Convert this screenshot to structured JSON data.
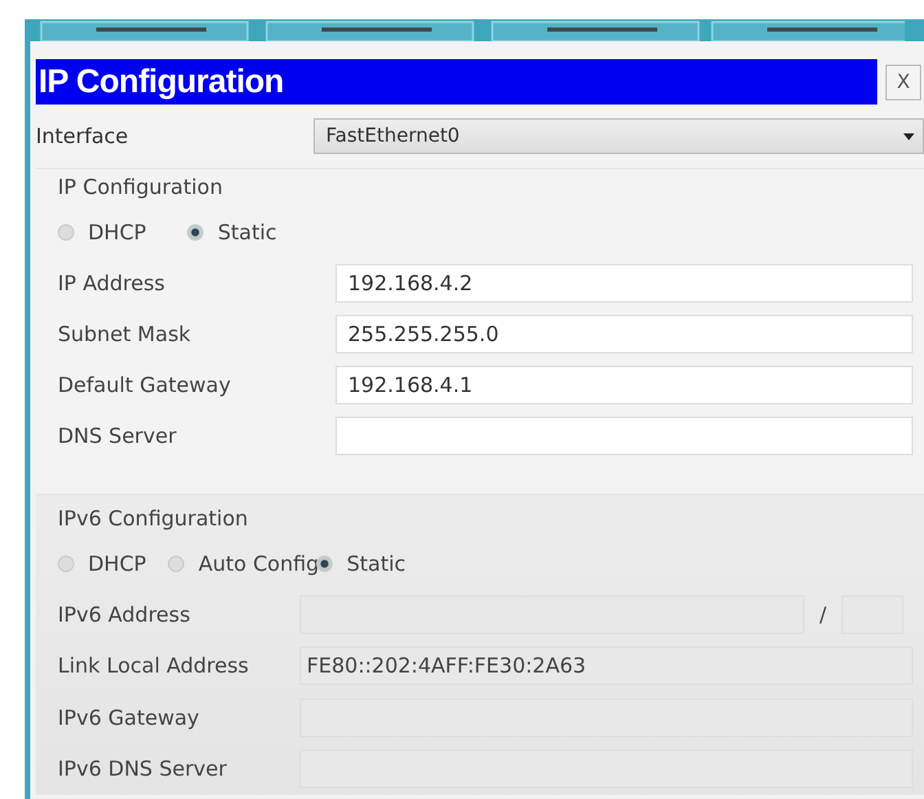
{
  "window": {
    "title": "IP Configuration",
    "close": "X"
  },
  "interface": {
    "label": "Interface",
    "value": "FastEthernet0"
  },
  "ipv4": {
    "legend": "IP Configuration",
    "modes": [
      {
        "label": "DHCP",
        "selected": false
      },
      {
        "label": "Static",
        "selected": true
      }
    ],
    "fields": [
      {
        "label": "IP Address",
        "value": "192.168.4.2",
        "disabled": false
      },
      {
        "label": "Subnet Mask",
        "value": "255.255.255.0",
        "disabled": false
      },
      {
        "label": "Default Gateway",
        "value": "192.168.4.1",
        "disabled": false
      },
      {
        "label": "DNS Server",
        "disabled": false
      }
    ]
  },
  "ipv6": {
    "legend": "IPv6 Configuration",
    "modes": [
      {
        "label": "DHCP",
        "selected": false
      },
      {
        "label": "Auto Config",
        "selected": false
      },
      {
        "label": "Static",
        "selected": true
      }
    ],
    "fields": [
      {
        "kind": "prefix",
        "label": "IPv6 Address",
        "separator": "/",
        "disabled": true
      },
      {
        "kind": "plain",
        "label": "Link Local Address",
        "value": "FE80::202:4AFF:FE30:2A63",
        "disabled": true
      },
      {
        "kind": "plain",
        "label": "IPv6 Gateway",
        "disabled": true
      },
      {
        "kind": "plain",
        "label": "IPv6 DNS Server",
        "disabled": true
      }
    ]
  }
}
